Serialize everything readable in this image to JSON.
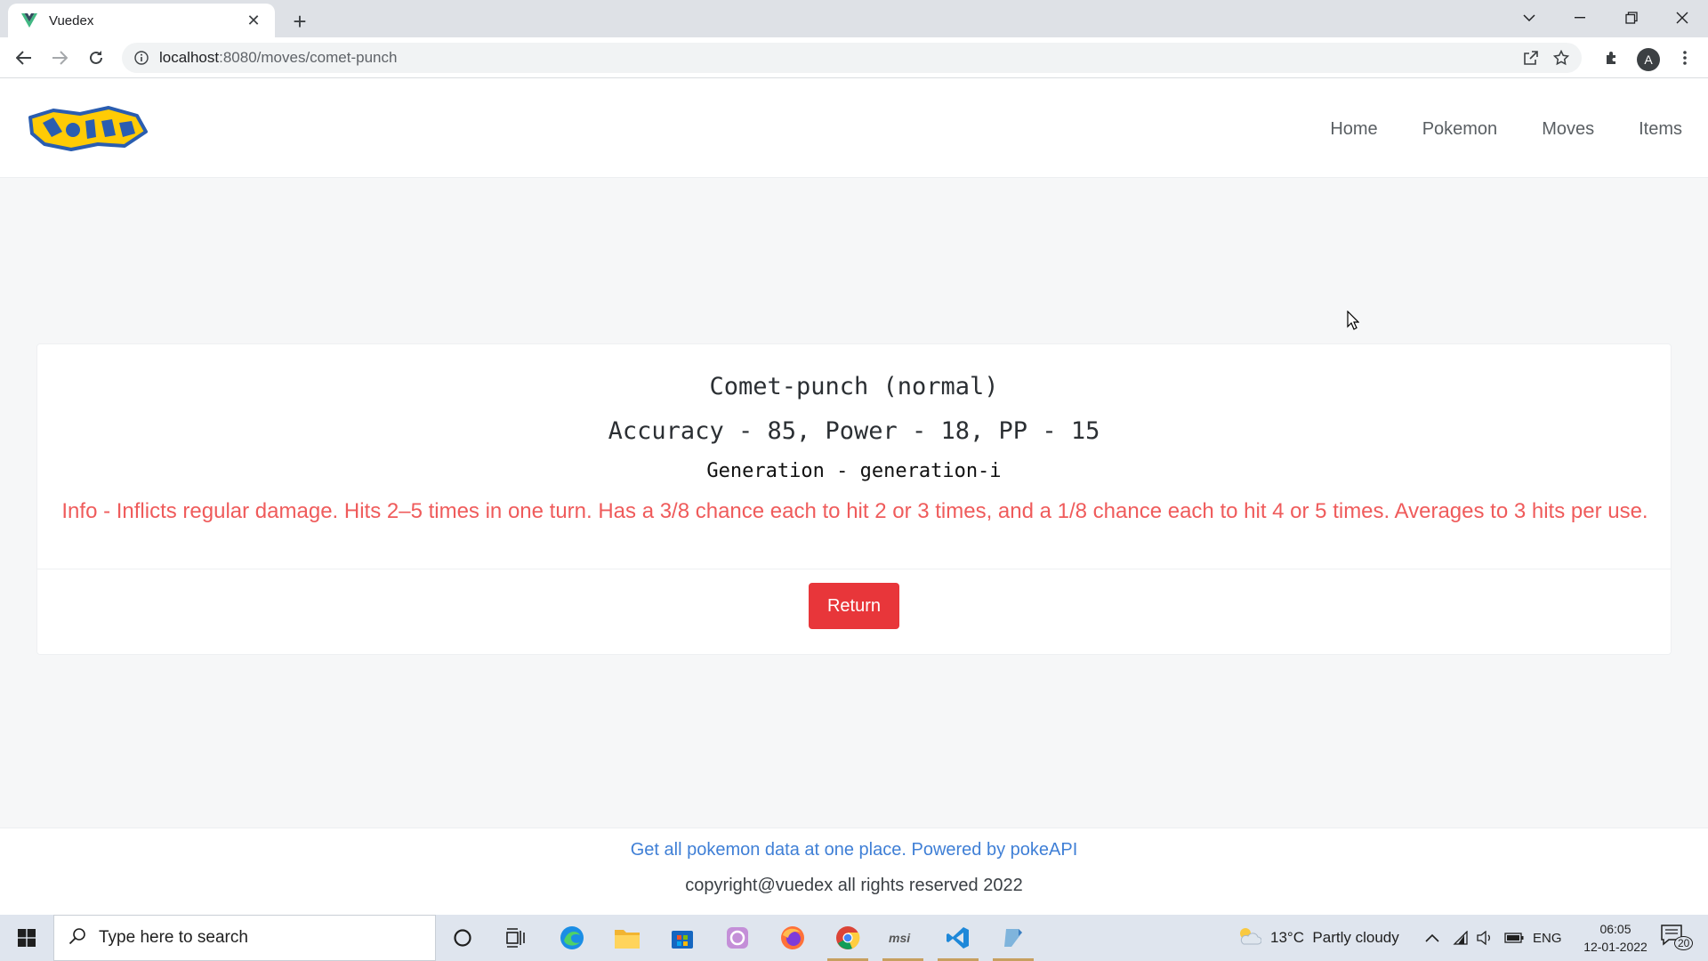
{
  "browser": {
    "tab_title": "Vuedex",
    "url_host": "localhost",
    "url_rest": ":8080/moves/comet-punch"
  },
  "profile": {
    "initial": "A"
  },
  "navbar": {
    "links": [
      "Home",
      "Pokemon",
      "Moves",
      "Items"
    ]
  },
  "move": {
    "name_line": "Comet-punch (normal)",
    "stats_line": "Accuracy - 85, Power - 18, PP - 15",
    "generation_line": "Generation - generation-i",
    "info_line": "Info - Inflicts regular damage. Hits 2–5 times in one turn. Has a 3/8 chance each to hit 2 or 3 times, and a 1/8 chance each to hit 4 or 5 times. Averages to 3 hits per use.",
    "return_label": "Return"
  },
  "footer": {
    "link_text": "Get all pokemon data at one place. Powered by pokeAPI",
    "copyright": "copyright@vuedex all rights reserved 2022"
  },
  "taskbar": {
    "search_placeholder": "Type here to search",
    "weather": "13°C  Partly cloudy",
    "language": "ENG",
    "time": "06:05",
    "date": "12-01-2022",
    "notification_count": "20"
  },
  "colors": {
    "accent_red": "#e8363a",
    "info_red": "#ef5b5b",
    "link_blue": "#3f7fd6"
  }
}
